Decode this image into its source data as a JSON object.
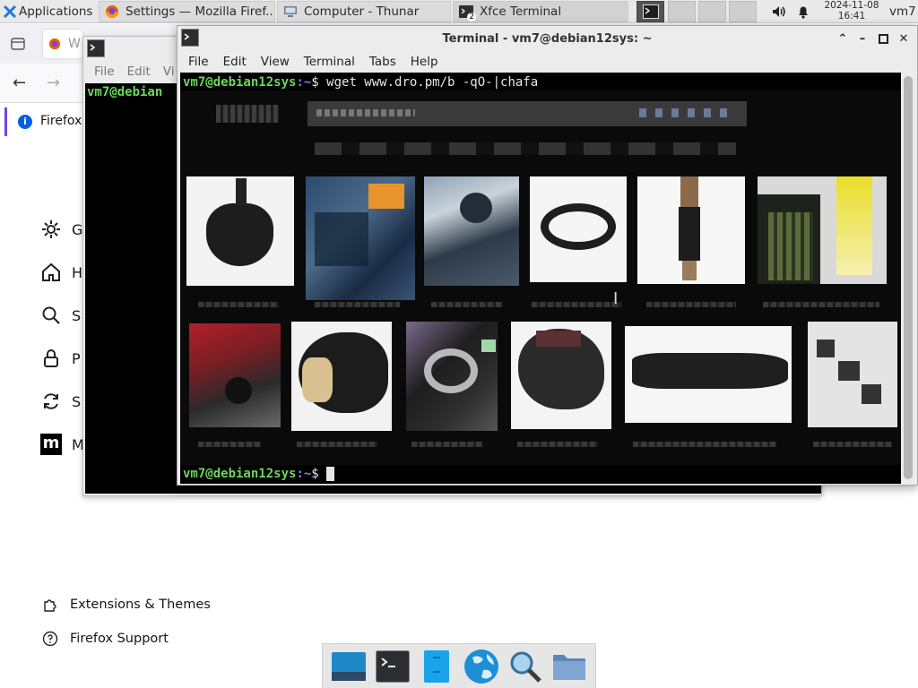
{
  "panel": {
    "applications_label": "Applications",
    "tasks": [
      {
        "label": "Settings — Mozilla Firef...",
        "icon": "firefox-icon"
      },
      {
        "label": "Computer - Thunar",
        "icon": "computer-icon"
      },
      {
        "label": "Xfce Terminal",
        "icon": "terminal-icon",
        "badge": "2"
      }
    ],
    "clock_date": "2024-11-08",
    "clock_time": "16:41",
    "user": "vm7"
  },
  "firefox": {
    "tab_label": "W",
    "firefox_tab_label": "Firefox",
    "sidebar": [
      {
        "label": "G",
        "icon": "gear-icon"
      },
      {
        "label": "H",
        "icon": "home-icon"
      },
      {
        "label": "S",
        "icon": "search-icon"
      },
      {
        "label": "P",
        "icon": "lock-icon"
      },
      {
        "label": "S",
        "icon": "sync-icon"
      },
      {
        "label": "M",
        "icon": "mozilla-icon"
      }
    ],
    "extensions_label": "Extensions & Themes",
    "support_label": "Firefox Support"
  },
  "bg_terminal": {
    "menu": [
      "File",
      "Edit",
      "Vi"
    ],
    "prompt_user": "vm7@debian"
  },
  "terminal": {
    "title": "Terminal - vm7@debian12sys: ~",
    "menu": [
      "File",
      "Edit",
      "View",
      "Terminal",
      "Tabs",
      "Help"
    ],
    "prompt_user": "vm7@debian12sys",
    "prompt_path": ":~",
    "prompt_symbol": "$",
    "command": " wget www.dro.pm/b -qO-|chafa"
  },
  "dock": {
    "items": [
      "show-desktop-icon",
      "terminal-icon",
      "file-manager-icon",
      "web-browser-icon",
      "app-finder-icon",
      "folder-icon"
    ]
  },
  "colors": {
    "prompt_user": "#6bd75b",
    "prompt_path": "#6b8be8",
    "terminal_bg": "#000000",
    "panel_bg": "#e9e9e9"
  }
}
